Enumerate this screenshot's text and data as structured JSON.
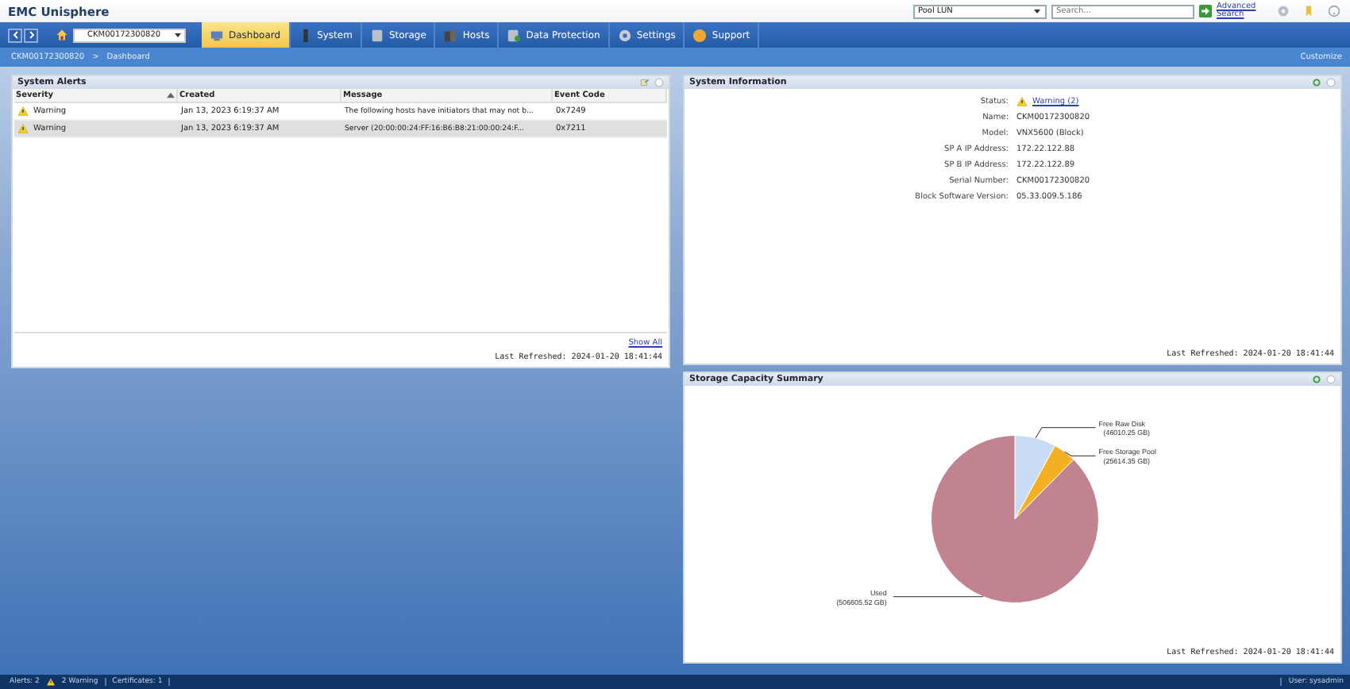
{
  "app_title": "EMC Unisphere",
  "header": {
    "scope_select": "Pool LUN",
    "search": {
      "placeholder": "Search..."
    },
    "advanced_search": "Advanced Search"
  },
  "nav": {
    "system_select": "CKM00172300820",
    "tabs": [
      {
        "label": "Dashboard",
        "selected": true
      },
      {
        "label": "System",
        "selected": false
      },
      {
        "label": "Storage",
        "selected": false
      },
      {
        "label": "Hosts",
        "selected": false
      },
      {
        "label": "Data Protection",
        "selected": false
      },
      {
        "label": "Settings",
        "selected": false
      },
      {
        "label": "Support",
        "selected": false
      }
    ]
  },
  "breadcrumb": {
    "items": [
      "CKM00172300820",
      "Dashboard"
    ],
    "separator": ">",
    "customize": "Customize"
  },
  "alerts_panel": {
    "title": "System Alerts",
    "columns": [
      "Severity",
      "Created",
      "Message",
      "Event Code"
    ],
    "rows": [
      {
        "severity": "Warning",
        "created": "Jan 13, 2023 6:19:37 AM",
        "message": "The following hosts have initiators that may not b...",
        "event_code": "0x7249",
        "selected": false
      },
      {
        "severity": "Warning",
        "created": "Jan 13, 2023 6:19:37 AM",
        "message": "Server (20:00:00:24:FF:16:B6:B8:21:00:00:24:F...",
        "event_code": "0x7211",
        "selected": true
      }
    ],
    "show_all": "Show All",
    "last_refreshed": "Last Refreshed: 2024-01-20 18:41:44"
  },
  "system_info": {
    "title": "System Information",
    "fields": [
      {
        "label": "Status:",
        "value": "Warning (2)",
        "kind": "link"
      },
      {
        "label": "Name:",
        "value": "CKM00172300820",
        "kind": "text"
      },
      {
        "label": "Model:",
        "value": "VNX5600 (Block)",
        "kind": "text"
      },
      {
        "label": "SP A IP Address:",
        "value": "172.22.122.88",
        "kind": "text"
      },
      {
        "label": "SP B IP Address:",
        "value": "172.22.122.89",
        "kind": "text"
      },
      {
        "label": "Serial Number:",
        "value": "CKM00172300820",
        "kind": "text"
      },
      {
        "label": "Block Software Version:",
        "value": "05.33.009.5.186",
        "kind": "text"
      }
    ],
    "last_refreshed": "Last Refreshed: 2024-01-20 18:41:44"
  },
  "capacity_panel": {
    "title": "Storage Capacity Summary",
    "chart_data": {
      "type": "pie",
      "categories": [
        "Free Raw Disk",
        "Free Storage Pool",
        "Used"
      ],
      "values": [
        46010.25,
        25614.35,
        506605.52
      ],
      "colors": [
        "#c9dcf5",
        "#f5b022",
        "#c1838f"
      ],
      "value_labels": [
        "(46010.25 GB)",
        "(25614.35 GB)",
        "(506605.52 GB)"
      ]
    },
    "last_refreshed": "Last Refreshed: 2024-01-20 18:41:44"
  },
  "status_bar": {
    "alerts": "Alerts: 2",
    "warnings": "2 Warning",
    "certificates": "Certificates: 1",
    "user": "User: sysadmin"
  }
}
